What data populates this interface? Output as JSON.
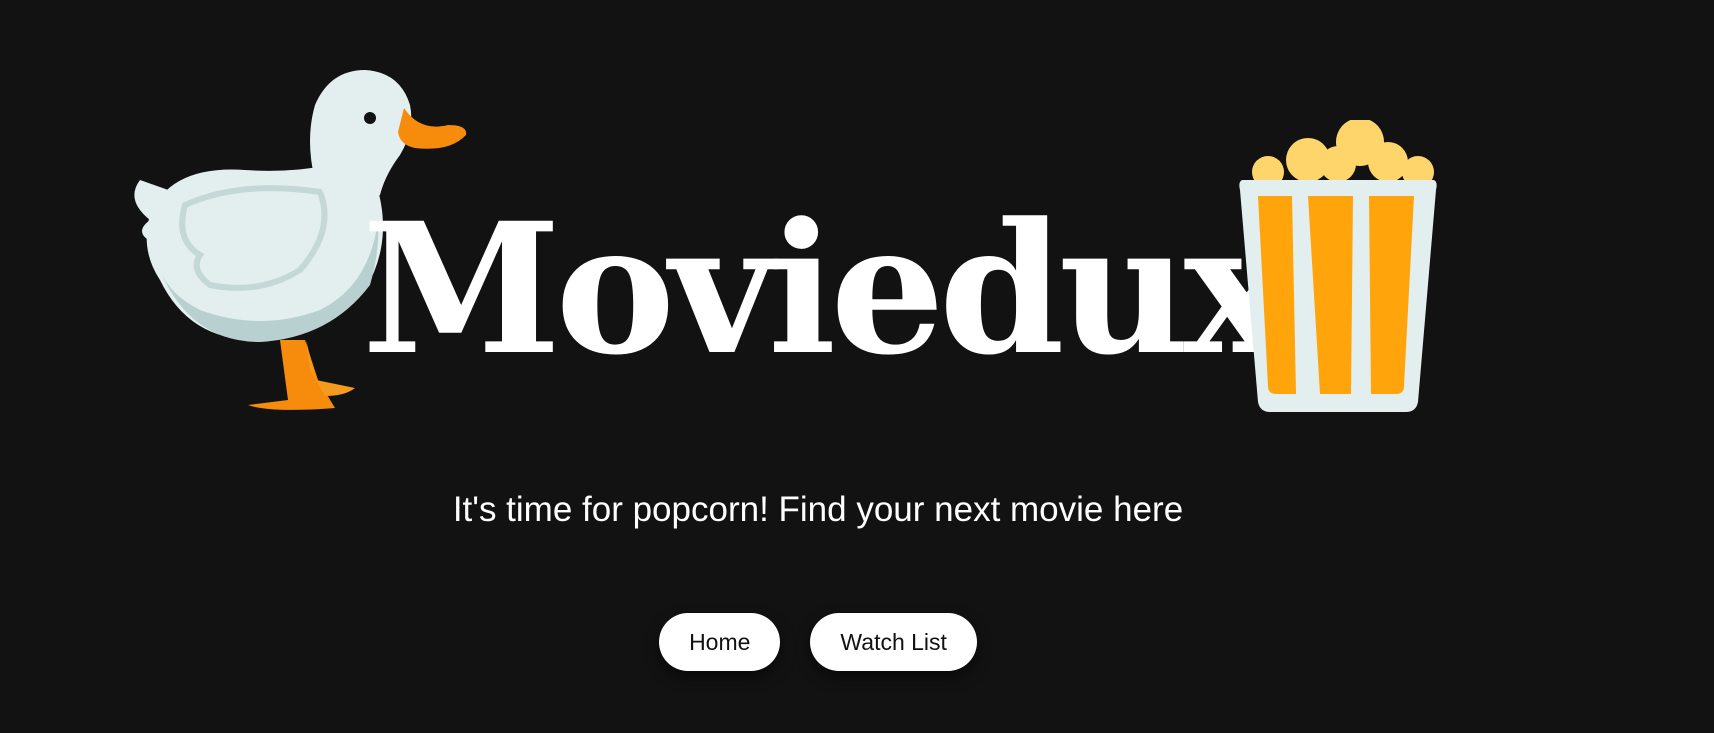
{
  "header": {
    "brand": "Moviedux",
    "logo_left_icon": "duck-icon",
    "logo_right_icon": "popcorn-icon",
    "tagline": "It's time for popcorn! Find your next movie here"
  },
  "nav": {
    "items": [
      {
        "label": "Home"
      },
      {
        "label": "Watch List"
      }
    ]
  },
  "colors": {
    "background": "#121212",
    "text": "#ffffff",
    "button_bg": "#ffffff",
    "popcorn_stripe": "#FFA40B",
    "duck_body": "#E3EEEE",
    "duck_beak": "#F78C0C"
  }
}
